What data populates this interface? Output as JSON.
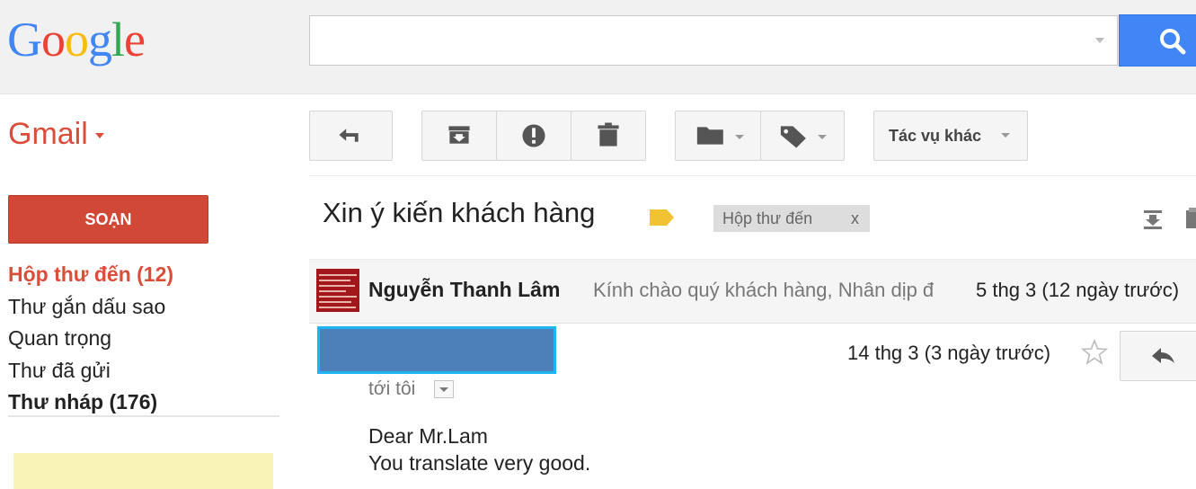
{
  "logo": {
    "letters": [
      "G",
      "o",
      "o",
      "g",
      "l",
      "e"
    ]
  },
  "search": {
    "value": "",
    "placeholder": ""
  },
  "app": {
    "name": "Gmail"
  },
  "compose_label": "SOẠN",
  "nav": [
    {
      "label": "Hộp thư đến (12)"
    },
    {
      "label": "Thư gắn dấu sao"
    },
    {
      "label": "Quan trọng"
    },
    {
      "label": "Thư đã gửi"
    },
    {
      "label": "Thư nháp (176)"
    }
  ],
  "toolbar": {
    "more_label": "Tác vụ khác"
  },
  "thread": {
    "subject": "Xin ý kiến khách hàng",
    "label": "Hộp thư đến",
    "label_remove": "x"
  },
  "messages": [
    {
      "sender": "Nguyễn Thanh Lâm",
      "snippet": "Kính chào quý khách hàng, Nhân dịp đ",
      "date": "5 thg 3 (12 ngày trước)"
    },
    {
      "date": "14 thg 3 (3 ngày trước)",
      "to": "tới tôi",
      "body": [
        "Dear Mr.Lam",
        "You translate very good."
      ]
    }
  ],
  "colors": {
    "accent_red": "#dd4b39",
    "compose_red": "#d14836",
    "search_blue": "#4285f4",
    "label_yellow": "#f1c232"
  }
}
